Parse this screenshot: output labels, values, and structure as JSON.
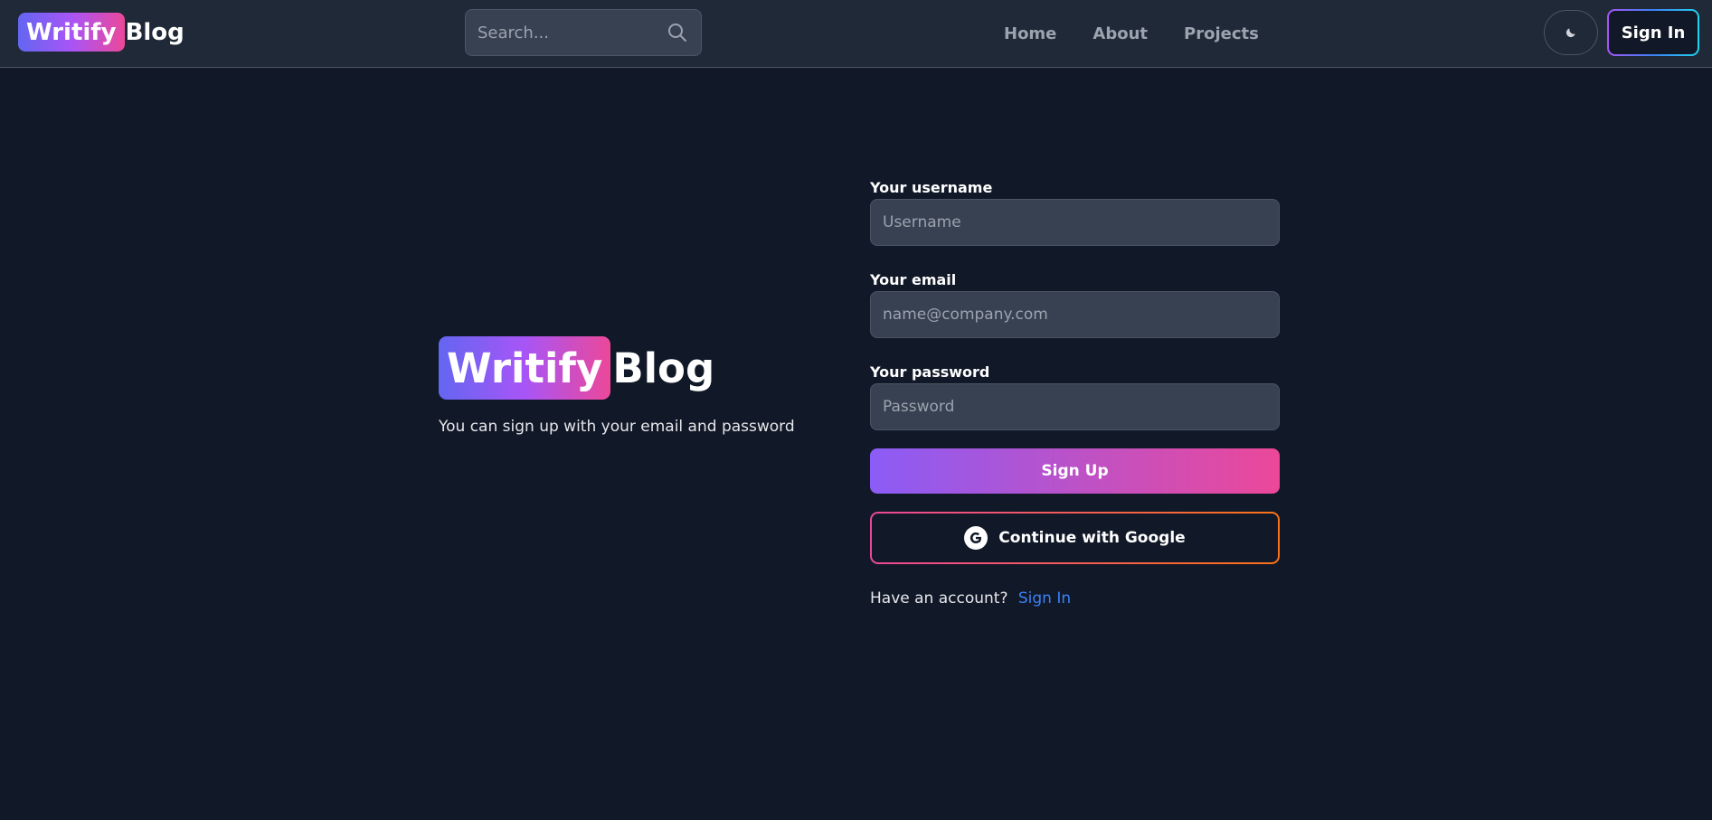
{
  "navbar": {
    "brand_badge": "Writify",
    "brand_rest": "Blog",
    "search_placeholder": "Search...",
    "links": [
      {
        "label": "Home"
      },
      {
        "label": "About"
      },
      {
        "label": "Projects"
      }
    ],
    "theme_icon": "moon-icon",
    "signin_label": "Sign In"
  },
  "hero": {
    "brand_badge": "Writify",
    "brand_rest": "Blog",
    "subtitle": "You can sign up with your email and password"
  },
  "form": {
    "username_label": "Your username",
    "username_placeholder": "Username",
    "email_label": "Your email",
    "email_placeholder": "name@company.com",
    "password_label": "Your password",
    "password_placeholder": "Password",
    "signup_label": "Sign Up",
    "google_label": "Continue with Google",
    "have_account_text": "Have an account?",
    "signin_link": "Sign In"
  },
  "colors": {
    "background": "#111827",
    "navbar": "#1f2937",
    "input_bg": "#374151",
    "gradient_start": "#8b5cf6",
    "gradient_end": "#ec4899",
    "link": "#3b82f6"
  }
}
